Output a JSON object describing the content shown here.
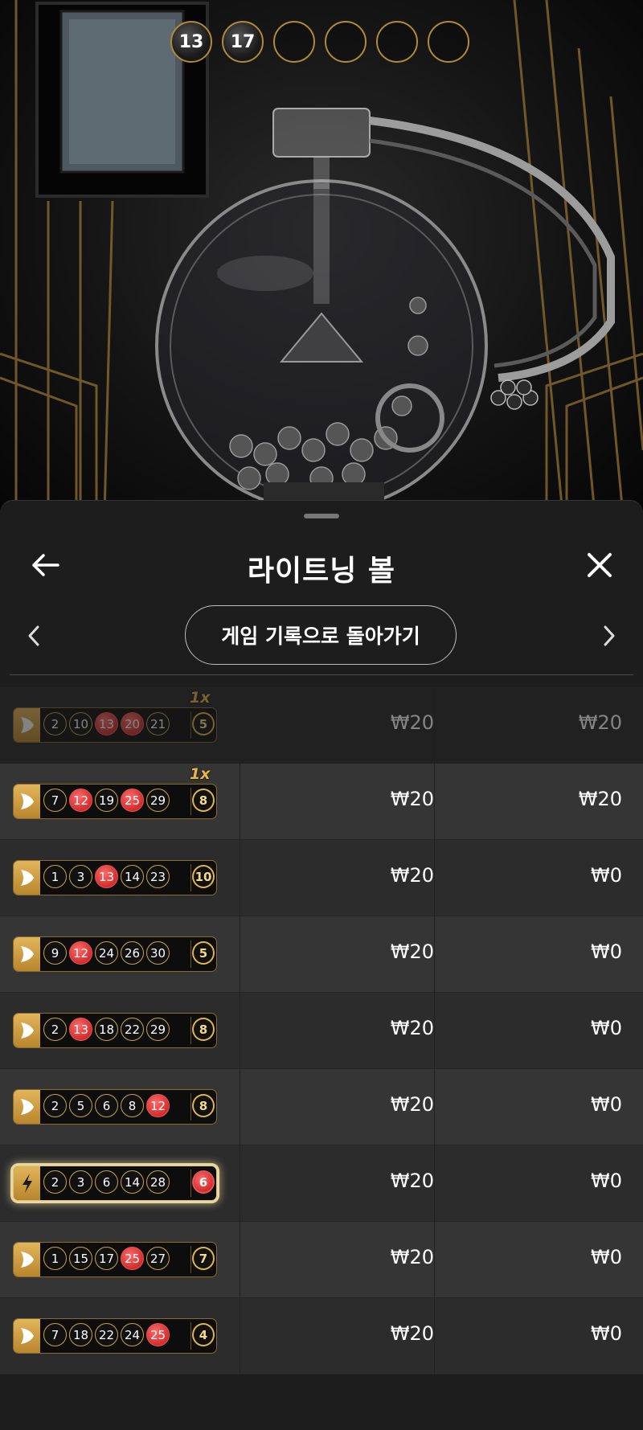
{
  "drawn_balls": [
    {
      "value": "13",
      "state": "filled"
    },
    {
      "value": "17",
      "state": "filled"
    },
    {
      "value": "",
      "state": "empty"
    },
    {
      "value": "",
      "state": "empty"
    },
    {
      "value": "",
      "state": "empty"
    },
    {
      "value": "",
      "state": "empty"
    }
  ],
  "sheet": {
    "title": "라이트닝 볼",
    "history_button_label": "게임 기록으로 돌아가기"
  },
  "colors": {
    "accent_gold": "#c9a04a",
    "hit_red": "#d42c2c",
    "sheet_bg": "#1d1d1d"
  },
  "rows": [
    {
      "icon": "play-icon",
      "numbers": [
        "2",
        "10",
        "13",
        "20",
        "21"
      ],
      "hits": [
        false,
        false,
        true,
        true,
        false
      ],
      "bonus": "5",
      "bonus_hit": false,
      "multiplier": "1x",
      "bet": "₩20",
      "win": "₩20",
      "faded": true,
      "lightning": false
    },
    {
      "icon": "play-icon",
      "numbers": [
        "7",
        "12",
        "19",
        "25",
        "29"
      ],
      "hits": [
        false,
        true,
        false,
        true,
        false
      ],
      "bonus": "8",
      "bonus_hit": false,
      "multiplier": "1x",
      "bet": "₩20",
      "win": "₩20",
      "faded": false,
      "lightning": false
    },
    {
      "icon": "play-icon",
      "numbers": [
        "1",
        "3",
        "13",
        "14",
        "23"
      ],
      "hits": [
        false,
        false,
        true,
        false,
        false
      ],
      "bonus": "10",
      "bonus_hit": false,
      "multiplier": "",
      "bet": "₩20",
      "win": "₩0",
      "faded": false,
      "lightning": false
    },
    {
      "icon": "play-icon",
      "numbers": [
        "9",
        "12",
        "24",
        "26",
        "30"
      ],
      "hits": [
        false,
        true,
        false,
        false,
        false
      ],
      "bonus": "5",
      "bonus_hit": false,
      "multiplier": "",
      "bet": "₩20",
      "win": "₩0",
      "faded": false,
      "lightning": false
    },
    {
      "icon": "play-icon",
      "numbers": [
        "2",
        "13",
        "18",
        "22",
        "29"
      ],
      "hits": [
        false,
        true,
        false,
        false,
        false
      ],
      "bonus": "8",
      "bonus_hit": false,
      "multiplier": "",
      "bet": "₩20",
      "win": "₩0",
      "faded": false,
      "lightning": false
    },
    {
      "icon": "play-icon",
      "numbers": [
        "2",
        "5",
        "6",
        "8",
        "12"
      ],
      "hits": [
        false,
        false,
        false,
        false,
        true
      ],
      "bonus": "8",
      "bonus_hit": false,
      "multiplier": "",
      "bet": "₩20",
      "win": "₩0",
      "faded": false,
      "lightning": false
    },
    {
      "icon": "lightning-icon",
      "numbers": [
        "2",
        "3",
        "6",
        "14",
        "28"
      ],
      "hits": [
        false,
        false,
        false,
        false,
        false
      ],
      "bonus": "6",
      "bonus_hit": true,
      "multiplier": "",
      "bet": "₩20",
      "win": "₩0",
      "faded": false,
      "lightning": true
    },
    {
      "icon": "play-icon",
      "numbers": [
        "1",
        "15",
        "17",
        "25",
        "27"
      ],
      "hits": [
        false,
        false,
        false,
        true,
        false
      ],
      "bonus": "7",
      "bonus_hit": false,
      "multiplier": "",
      "bet": "₩20",
      "win": "₩0",
      "faded": false,
      "lightning": false
    },
    {
      "icon": "play-icon",
      "numbers": [
        "7",
        "18",
        "22",
        "24",
        "25"
      ],
      "hits": [
        false,
        false,
        false,
        false,
        true
      ],
      "bonus": "4",
      "bonus_hit": false,
      "multiplier": "",
      "bet": "₩20",
      "win": "₩0",
      "faded": false,
      "lightning": false
    }
  ]
}
